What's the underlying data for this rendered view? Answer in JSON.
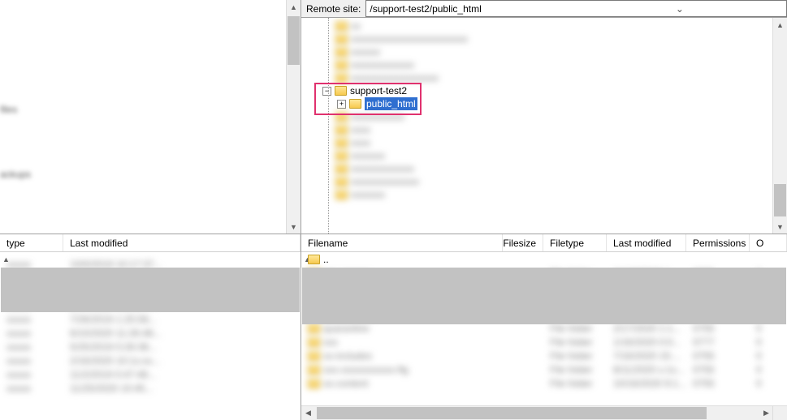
{
  "remote": {
    "label": "Remote site:",
    "path": "/support-test2/public_html",
    "tree": {
      "focus_folder": "support-test2",
      "selected_child": "public_html"
    }
  },
  "local_top": {
    "labels": {
      "files": "files",
      "backups": "ackups"
    }
  },
  "local_list": {
    "headers": {
      "type": "type",
      "modified": "Last modified"
    }
  },
  "remote_list": {
    "headers": {
      "filename": "Filename",
      "filesize": "Filesize",
      "filetype": "Filetype",
      "modified": "Last modified",
      "permissions": "Permissions",
      "owner": "O"
    },
    "updir": ".."
  }
}
